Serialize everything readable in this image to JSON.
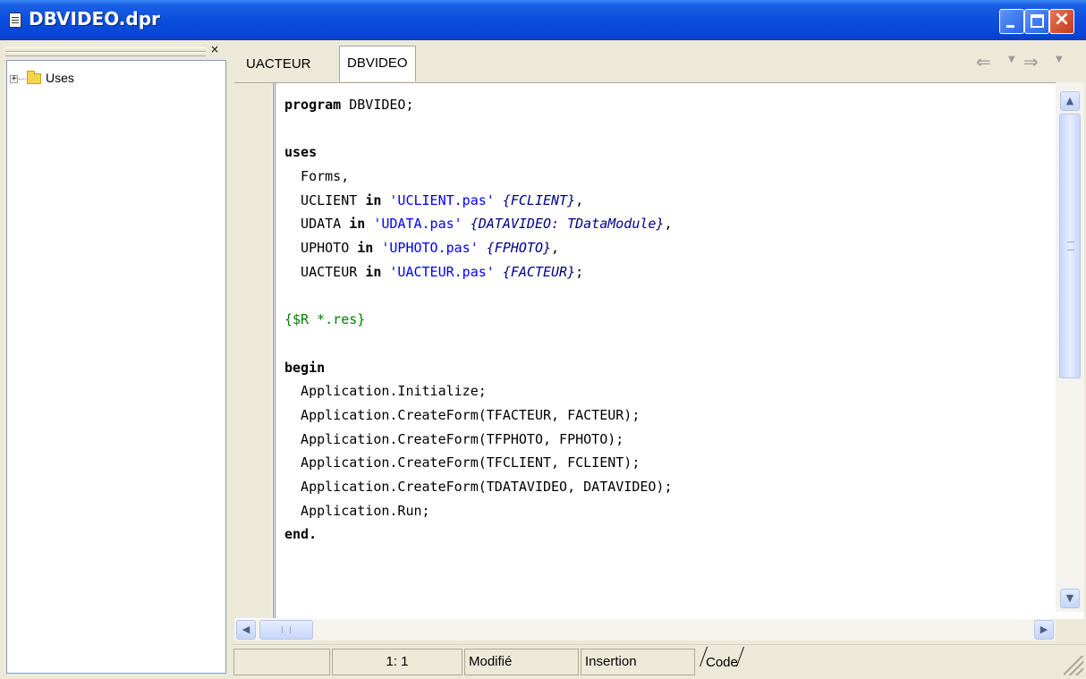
{
  "window": {
    "title": "DBVIDEO.dpr",
    "icon": "document-icon",
    "buttons": {
      "minimize": "minimize",
      "maximize": "maximize",
      "close": "close"
    }
  },
  "explorer": {
    "close_label": "×",
    "tree": [
      {
        "expander": "+",
        "icon": "folder-icon",
        "label": "Uses"
      }
    ]
  },
  "tabs": [
    {
      "label": "UACTEUR",
      "active": false
    },
    {
      "label": "DBVIDEO",
      "active": true
    }
  ],
  "navigation": {
    "back": "⇐",
    "back_dropdown": "▼",
    "forward": "⇒",
    "forward_dropdown": "▼"
  },
  "code": {
    "lines": [
      [
        {
          "t": "program",
          "c": "kw"
        },
        {
          "t": " DBVIDEO;",
          "c": ""
        }
      ],
      [],
      [
        {
          "t": "uses",
          "c": "kw"
        }
      ],
      [
        {
          "t": "  Forms,",
          "c": ""
        }
      ],
      [
        {
          "t": "  UCLIENT ",
          "c": ""
        },
        {
          "t": "in",
          "c": "kw"
        },
        {
          "t": " ",
          "c": ""
        },
        {
          "t": "'UCLIENT.pas'",
          "c": "str"
        },
        {
          "t": " ",
          "c": ""
        },
        {
          "t": "{FCLIENT}",
          "c": "cmt"
        },
        {
          "t": ",",
          "c": ""
        }
      ],
      [
        {
          "t": "  UDATA ",
          "c": ""
        },
        {
          "t": "in",
          "c": "kw"
        },
        {
          "t": " ",
          "c": ""
        },
        {
          "t": "'UDATA.pas'",
          "c": "str"
        },
        {
          "t": " ",
          "c": ""
        },
        {
          "t": "{DATAVIDEO: TDataModule}",
          "c": "cmt"
        },
        {
          "t": ",",
          "c": ""
        }
      ],
      [
        {
          "t": "  UPHOTO ",
          "c": ""
        },
        {
          "t": "in",
          "c": "kw"
        },
        {
          "t": " ",
          "c": ""
        },
        {
          "t": "'UPHOTO.pas'",
          "c": "str"
        },
        {
          "t": " ",
          "c": ""
        },
        {
          "t": "{FPHOTO}",
          "c": "cmt"
        },
        {
          "t": ",",
          "c": ""
        }
      ],
      [
        {
          "t": "  UACTEUR ",
          "c": ""
        },
        {
          "t": "in",
          "c": "kw"
        },
        {
          "t": " ",
          "c": ""
        },
        {
          "t": "'UACTEUR.pas'",
          "c": "str"
        },
        {
          "t": " ",
          "c": ""
        },
        {
          "t": "{FACTEUR}",
          "c": "cmt"
        },
        {
          "t": ";",
          "c": ""
        }
      ],
      [],
      [
        {
          "t": "{$R *.res}",
          "c": "dir"
        }
      ],
      [],
      [
        {
          "t": "begin",
          "c": "kw"
        }
      ],
      [
        {
          "t": "  Application.Initialize;",
          "c": ""
        }
      ],
      [
        {
          "t": "  Application.CreateForm(TFACTEUR, FACTEUR);",
          "c": ""
        }
      ],
      [
        {
          "t": "  Application.CreateForm(TFPHOTO, FPHOTO);",
          "c": ""
        }
      ],
      [
        {
          "t": "  Application.CreateForm(TFCLIENT, FCLIENT);",
          "c": ""
        }
      ],
      [
        {
          "t": "  Application.CreateForm(TDATAVIDEO, DATAVIDEO);",
          "c": ""
        }
      ],
      [
        {
          "t": "  Application.Run;",
          "c": ""
        }
      ],
      [
        {
          "t": "end.",
          "c": "kw"
        }
      ]
    ]
  },
  "scrollbars": {
    "up": "▲",
    "down": "▼",
    "left": "◀",
    "right": "▶"
  },
  "statusbar": {
    "panel1": "",
    "position": "1:  1",
    "modified": "Modifié",
    "mode": "Insertion",
    "view_tab": "Code"
  },
  "colors": {
    "titlebar": "#0a4ede",
    "keyword": "#000000",
    "string": "#0000ff",
    "comment": "#000080",
    "directive": "#008000"
  }
}
